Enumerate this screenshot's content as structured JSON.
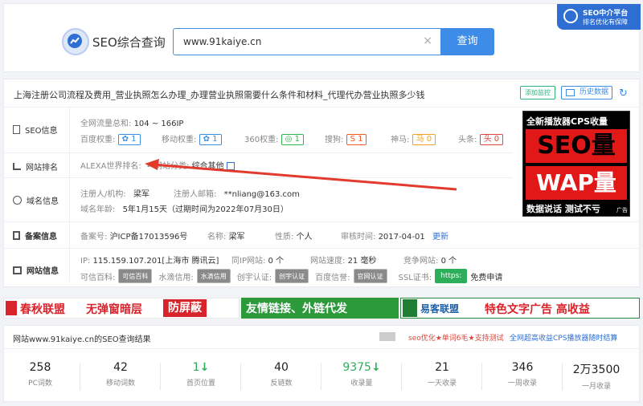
{
  "header": {
    "logo_text": "SEO综合查询",
    "search_value": "www.91kaiye.cn",
    "search_button": "查询",
    "platform_badge_line1": "SEO中介平台",
    "platform_badge_line2": "排名优化有保障"
  },
  "site": {
    "title": "上海注册公司流程及费用_营业执照怎么办理_办理营业执照需要什么条件和材料_代理代办营业执照多少钱",
    "add_monitor": "添加监控",
    "history": "历史数据"
  },
  "seo_info": {
    "label": "SEO信息",
    "traffic_label": "全网流量总和:",
    "traffic_value": "104 ~ 166IP",
    "weights": [
      {
        "name": "百度权重:",
        "value": "1",
        "color": "#3b8fe6"
      },
      {
        "name": "移动权重:",
        "value": "1",
        "color": "#3b8fe6"
      },
      {
        "name": "360权重:",
        "value": "1",
        "color": "#2fb84b"
      },
      {
        "name": "搜狗:",
        "value": "1",
        "color": "#f05a24"
      },
      {
        "name": "神马:",
        "value": "0",
        "color": "#f0a21e"
      },
      {
        "name": "头条:",
        "value": "0",
        "color": "#e0463c"
      }
    ]
  },
  "rank": {
    "label": "网站排名",
    "alexa_label": "ALEXA世界排名:",
    "alexa_value": "-",
    "category_label": "网站分类:",
    "category_value": "综合其他"
  },
  "domain": {
    "label": "域名信息",
    "registrant_label": "注册人/机构:",
    "registrant_value": "梁军",
    "email_label": "注册人邮箱:",
    "email_value": "**nliang@163.com",
    "age_label": "域名年龄:",
    "age_value": "5年1月15天（过期时间为2022年07月30日）"
  },
  "icp": {
    "label": "备案信息",
    "number_label": "备案号:",
    "number_value": "沪ICP备17013596号",
    "name_label": "名称:",
    "name_value": "梁军",
    "nature_label": "性质:",
    "nature_value": "个人",
    "time_label": "审核时间:",
    "time_value": "2017-04-01",
    "update": "更新"
  },
  "web_info": {
    "label": "网站信息",
    "ip_label": "IP:",
    "ip_value": "115.159.107.201[上海市 腾讯云]",
    "same_ip_label": "同IP网站:",
    "same_ip_value": "0 个",
    "speed_label": "网站速度:",
    "speed_value": "21 毫秒",
    "competitor_label": "竞争网站:",
    "competitor_value": "0 个",
    "creds": [
      {
        "name": "可信百科:",
        "badge": "可信百科"
      },
      {
        "name": "水滴信用:",
        "badge": "水滴信用"
      },
      {
        "name": "创宇认证:",
        "badge": "创宇认证"
      },
      {
        "name": "百度信誉:",
        "badge": "官网认证"
      }
    ],
    "ssl_label": "SSL证书:",
    "ssl_badge": "https:",
    "ssl_apply": "免费申请"
  },
  "ad_box": {
    "line1": "全新播放器CPS收量",
    "line2": "SEO量",
    "line3": "WAP量",
    "line4": "数据说话  测试不亏",
    "tag": "广告"
  },
  "banners": [
    {
      "text1": "春秋联盟",
      "text2": "无弹窗暗层",
      "text3": "防屏蔽"
    },
    {
      "text1": "友情链接、外链代发"
    },
    {
      "text1": "易客联盟",
      "text2": "特色文字广告 高收益"
    }
  ],
  "results": {
    "title": "网站www.91kaiye.cn的SEO查询结果",
    "link1": "seo优化★单词6毛★支持测试",
    "link2": "全网超高收益CPS播放器随时结算",
    "stats": [
      {
        "value": "258",
        "label": "PC词数",
        "arrow": ""
      },
      {
        "value": "42",
        "label": "移动词数",
        "arrow": ""
      },
      {
        "value": "1",
        "label": "首页位置",
        "arrow": "↓"
      },
      {
        "value": "40",
        "label": "反链数",
        "arrow": ""
      },
      {
        "value": "9375",
        "label": "收录量",
        "arrow": "↓"
      },
      {
        "value": "21",
        "label": "一天收录",
        "arrow": ""
      },
      {
        "value": "346",
        "label": "一周收录",
        "arrow": ""
      },
      {
        "value": "2万3500",
        "label": "一月收录",
        "arrow": ""
      }
    ]
  }
}
